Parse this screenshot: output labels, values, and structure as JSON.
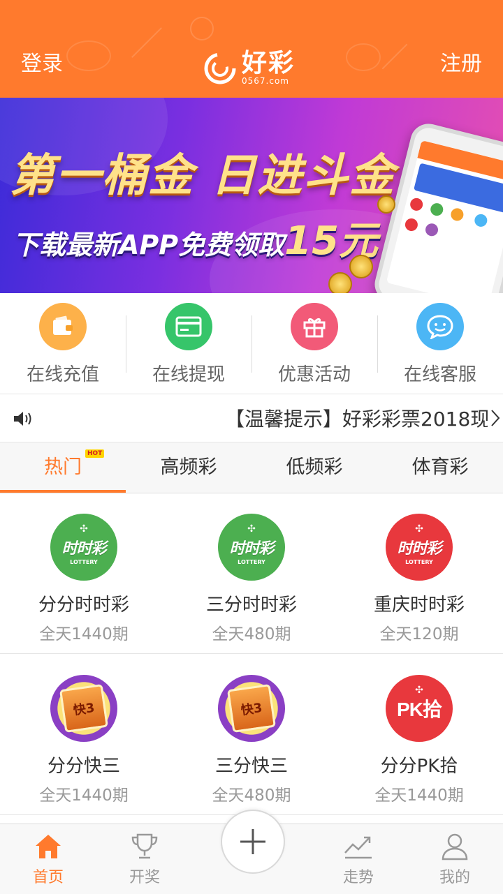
{
  "header": {
    "login_label": "登录",
    "register_label": "注册",
    "logo_text": "好彩",
    "logo_domain": "0567.com",
    "bg_color": "#ff7a2d"
  },
  "banner": {
    "title": "第一桶金 日进斗金",
    "subtitle_prefix": "下载最新APP免费领取",
    "subtitle_amount": "15元",
    "page_count": 5,
    "active_page_index": 3
  },
  "quick_actions": [
    {
      "label": "在线充值",
      "icon": "wallet-icon",
      "color": "#fdb14a"
    },
    {
      "label": "在线提现",
      "icon": "card-icon",
      "color": "#36c56a"
    },
    {
      "label": "优惠活动",
      "icon": "gift-icon",
      "color": "#f25a78"
    },
    {
      "label": "在线客服",
      "icon": "smile-chat-icon",
      "color": "#4cb6f5"
    }
  ],
  "notice": {
    "text": "【温馨提示】好彩彩票2018现"
  },
  "tabs": [
    {
      "label": "热门",
      "active": true,
      "badge": "HOT"
    },
    {
      "label": "高频彩",
      "active": false
    },
    {
      "label": "低频彩",
      "active": false
    },
    {
      "label": "体育彩",
      "active": false
    }
  ],
  "games": [
    {
      "name": "分分时时彩",
      "sub": "全天1440期",
      "logo": "ssc-logo",
      "logo_color": "#4caf50",
      "logo_text": "时时彩",
      "logo_sub": "LOTTERY"
    },
    {
      "name": "三分时时彩",
      "sub": "全天480期",
      "logo": "ssc-logo",
      "logo_color": "#4caf50",
      "logo_text": "时时彩",
      "logo_sub": "LOTTERY"
    },
    {
      "name": "重庆时时彩",
      "sub": "全天120期",
      "logo": "ssc-logo",
      "logo_color": "#e8383d",
      "logo_text": "时时彩",
      "logo_sub": "LOTTERY"
    },
    {
      "name": "分分快三",
      "sub": "全天1440期",
      "logo": "k3-logo",
      "logo_color": "#f7d54a",
      "logo_text": "快3"
    },
    {
      "name": "三分快三",
      "sub": "全天480期",
      "logo": "k3-logo",
      "logo_color": "#f7d54a",
      "logo_text": "快3"
    },
    {
      "name": "分分PK拾",
      "sub": "全天1440期",
      "logo": "pk10-logo",
      "logo_color": "#e8383d",
      "logo_text": "PK拾"
    }
  ],
  "bottom_nav": [
    {
      "label": "首页",
      "icon": "home-icon",
      "active": true
    },
    {
      "label": "开奖",
      "icon": "trophy-icon",
      "active": false
    },
    {
      "label": "走势",
      "icon": "trend-icon",
      "active": false
    },
    {
      "label": "我的",
      "icon": "user-icon",
      "active": false
    }
  ],
  "accent_color": "#ff7a2d"
}
